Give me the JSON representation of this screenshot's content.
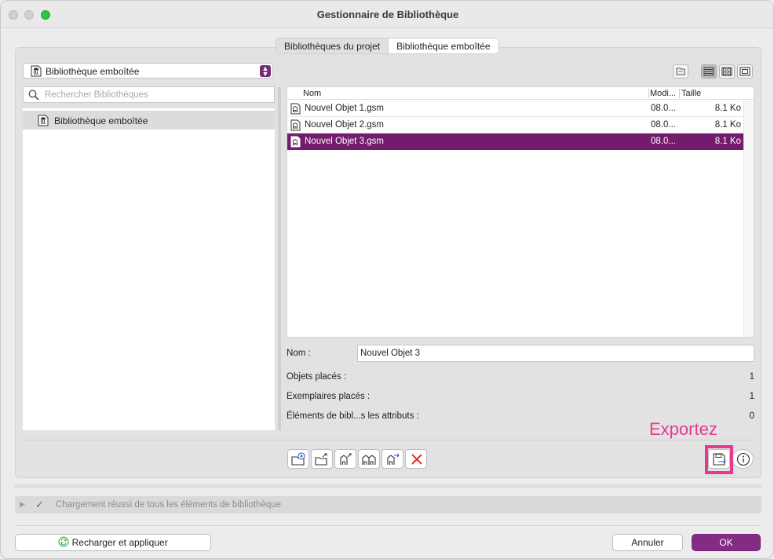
{
  "window": {
    "title": "Gestionnaire de Bibliothèque"
  },
  "tabs": [
    {
      "label": "Bibliothèques du projet"
    },
    {
      "label": "Bibliothèque emboîtée"
    }
  ],
  "library_select": {
    "value": "Bibliothèque emboîtée",
    "icon": "library-icon"
  },
  "search": {
    "placeholder": "Rechercher Bibliothèques",
    "icon": "search-icon"
  },
  "tree": {
    "items": [
      {
        "label": "Bibliothèque emboîtée",
        "icon": "library-icon"
      }
    ]
  },
  "file_list": {
    "columns": {
      "name": "Nom",
      "modified": "Modi...",
      "size": "Taille"
    },
    "rows": [
      {
        "name": "Nouvel Objet 1.gsm",
        "modified": "08.0...",
        "size": "8.1 Ko",
        "selected": false
      },
      {
        "name": "Nouvel Objet 2.gsm",
        "modified": "08.0...",
        "size": "8.1 Ko",
        "selected": false
      },
      {
        "name": "Nouvel Objet 3.gsm",
        "modified": "08.0...",
        "size": "8.1 Ko",
        "selected": true
      }
    ]
  },
  "properties": {
    "name_label": "Nom :",
    "name_value": "Nouvel Objet 3",
    "placed_objects_label": "Objets placés :",
    "placed_objects_value": "1",
    "placed_instances_label": "Exemplaires placés :",
    "placed_instances_value": "1",
    "attribute_elements_label": "Éléments de bibl...s les attributs :",
    "attribute_elements_value": "0"
  },
  "annotation": {
    "export_label": "Exportez",
    "color": "#e43b8c"
  },
  "status": {
    "text": "Chargement réussi de tous les éléments de bibliothèque"
  },
  "footer": {
    "reload_label": "Recharger et appliquer",
    "cancel_label": "Annuler",
    "ok_label": "OK"
  },
  "colors": {
    "accent": "#842b83",
    "selection": "#731c6e"
  }
}
